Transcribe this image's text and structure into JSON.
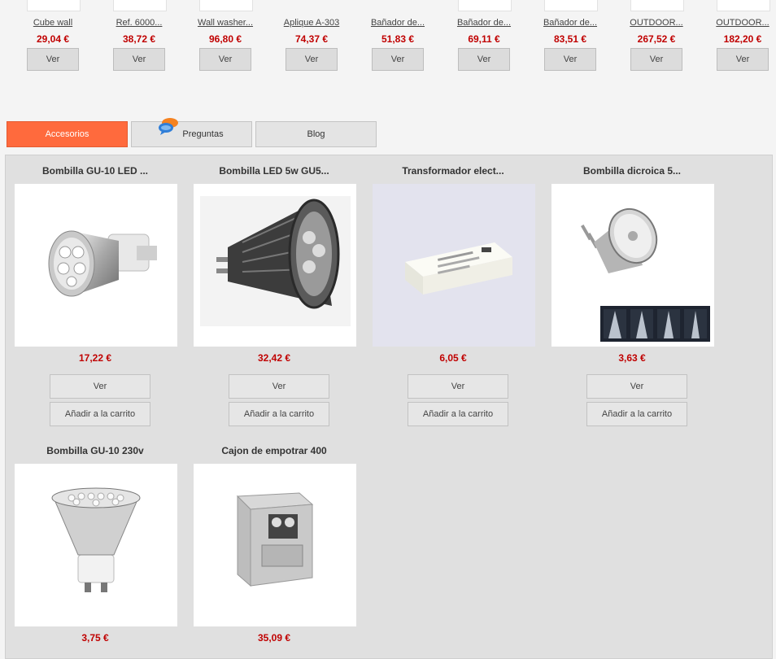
{
  "carousel": {
    "items": [
      {
        "title": "Cube wall",
        "price": "29,04 €",
        "button": "Ver"
      },
      {
        "title": "Ref. 6000...",
        "price": "38,72 €",
        "button": "Ver"
      },
      {
        "title": "Wall washer...",
        "price": "96,80 €",
        "button": "Ver"
      },
      {
        "title": "Aplique A-303",
        "price": "74,37 €",
        "button": "Ver"
      },
      {
        "title": "Bañador de...",
        "price": "51,83 €",
        "button": "Ver"
      },
      {
        "title": "Bañador de...",
        "price": "69,11 €",
        "button": "Ver"
      },
      {
        "title": "Bañador de...",
        "price": "83,51 €",
        "button": "Ver"
      },
      {
        "title": "OUTDOOR...",
        "price": "267,52 €",
        "button": "Ver"
      },
      {
        "title": "OUTDOOR...",
        "price": "182,20 €",
        "button": "Ver"
      }
    ]
  },
  "tabs": {
    "accesorios": "Accesorios",
    "preguntas": "Preguntas",
    "blog": "Blog"
  },
  "products": [
    {
      "title": "Bombilla GU-10 LED ...",
      "price": "17,22 €",
      "ver": "Ver",
      "cart": "Añadir a la carrito"
    },
    {
      "title": "Bombilla LED 5w GU5...",
      "price": "32,42 €",
      "ver": "Ver",
      "cart": "Añadir a la carrito"
    },
    {
      "title": "Transformador elect...",
      "price": "6,05 €",
      "ver": "Ver",
      "cart": "Añadir a la carrito"
    },
    {
      "title": "Bombilla dicroica 5...",
      "price": "3,63 €",
      "ver": "Ver",
      "cart": "Añadir a la carrito"
    },
    {
      "title": "Bombilla GU-10 230v",
      "price": "3,75 €"
    },
    {
      "title": "Cajon de empotrar 400",
      "price": "35,09 €"
    }
  ],
  "colors": {
    "accent": "#ff6a3d",
    "price": "#c00000",
    "panel": "#e0e0e0"
  }
}
